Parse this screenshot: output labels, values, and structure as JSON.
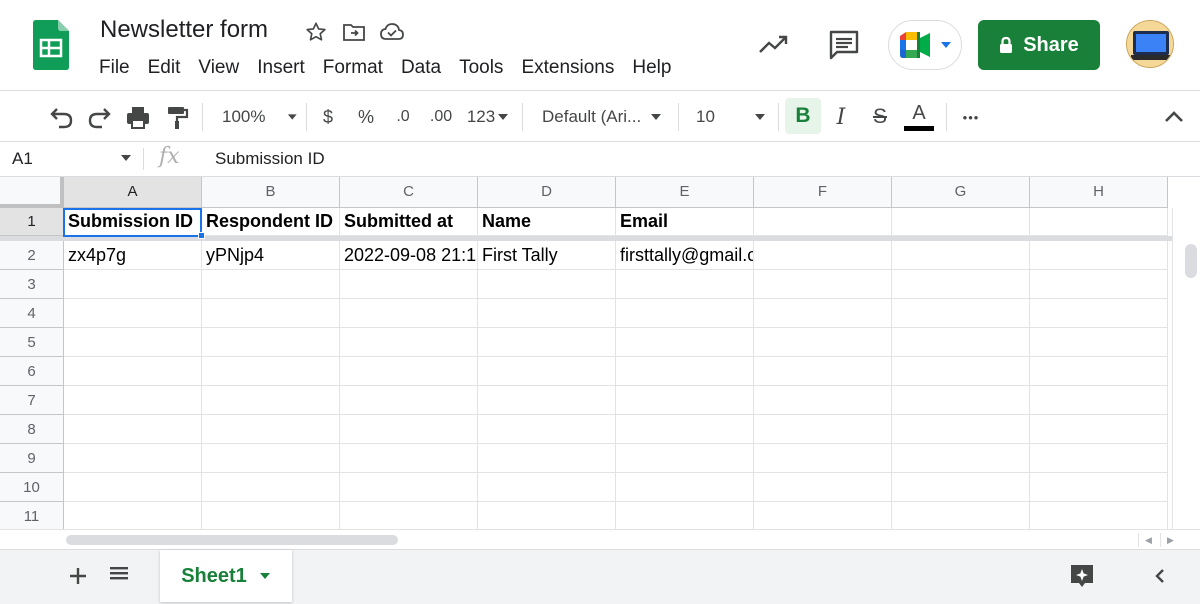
{
  "app": {
    "doc_title": "Newsletter form",
    "colors": {
      "brand_green": "#188038",
      "selection_blue": "#1a73e8",
      "sheets_logo": "#0f9d58"
    }
  },
  "menu": [
    "File",
    "Edit",
    "View",
    "Insert",
    "Format",
    "Data",
    "Tools",
    "Extensions",
    "Help"
  ],
  "header_actions": {
    "share_label": "Share",
    "icons": [
      "trending-up-icon",
      "comment-icon",
      "meet-icon",
      "lock-icon"
    ]
  },
  "toolbar": {
    "zoom": "100%",
    "currency": "$",
    "percent": "%",
    "decrease_decimal": ".0",
    "increase_decimal": ".00",
    "number_format": "123",
    "font": "Default (Ari...",
    "font_size": "10",
    "bold": "B",
    "italic": "I",
    "strikethrough": "S",
    "text_color": "A",
    "more": "•••"
  },
  "formula_bar": {
    "name_box": "A1",
    "fx": "fx",
    "value": "Submission ID"
  },
  "columns": [
    "A",
    "B",
    "C",
    "D",
    "E",
    "F",
    "G",
    "H"
  ],
  "rows": [
    "1",
    "2",
    "3",
    "4",
    "5",
    "6",
    "7",
    "8",
    "9",
    "10",
    "11"
  ],
  "cells": {
    "r1": [
      "Submission ID",
      "Respondent ID",
      "Submitted at",
      "Name",
      "Email",
      "",
      "",
      ""
    ],
    "r2": [
      "zx4p7g",
      "yPNjp4",
      "2022-09-08 21:1",
      "First Tally",
      "firsttally@gmail.com",
      "",
      "",
      ""
    ]
  },
  "sheets": [
    {
      "name": "Sheet1",
      "active": true
    }
  ]
}
